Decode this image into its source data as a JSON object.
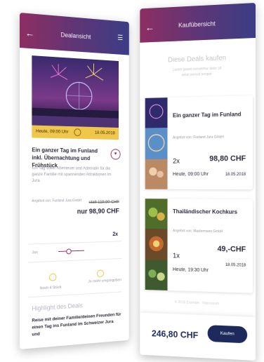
{
  "left": {
    "header": {
      "back": "←",
      "title": "Dealansicht",
      "menu": "☰"
    },
    "card": {
      "date": "Heute, 09:00 Uhr",
      "date_right": "18.05.2018"
    },
    "title": "Ein ganzer Tag im Funland inkl. Übernachtung und Frühstück",
    "description": "Ein Tag voller Abenteuer und Adrenalin für die ganze Familie mit spannenden Attraktionen im Jura",
    "provider": "Angebot von: Funland Jura GmbH",
    "price_old": "statt 119,90 CHF",
    "price_now": "nur 98,90 CHF",
    "quantity": "2x",
    "row1_left": "Jan",
    "row2_left": "Noch 4 Stück",
    "row2_right": "Je mehr umgangeben",
    "highlights_title": "Highlight des Deals",
    "highlights_text": "Reise mit deiner Familie/deinen Freunden für einen Tag ins Funland im Schweizer Jura und"
  },
  "right": {
    "header": {
      "back": "←",
      "title": "Kaufübersicht"
    },
    "heading": "Diese Deals kaufen",
    "subheading": "Lorem ipsum consetetur dolor sit amet eirmod tempor",
    "items": [
      {
        "title": "Ein ganzer Tag im Funland",
        "provider": "Angebot von: Funland Jura GmbH",
        "qty": "2x",
        "price": "98,80 CHF",
        "time": "Heute, 09:00 Uhr",
        "date": "18.05.2018"
      },
      {
        "title": "Thailändischer Kochkurs",
        "provider": "Angebot von: Mastermann GmbH",
        "qty": "1x",
        "price": "49,-CHF",
        "time": "Heute, 19:30 Uhr",
        "date": "18.05.2018"
      }
    ],
    "footer_note": "© 2018 Example · Impressum",
    "total": "246,80 CHF",
    "buy_label": "Kaufen"
  },
  "colors": {
    "purple": "#5f3576",
    "magenta": "#8e2e62",
    "navy": "#1f2a5c",
    "gold": "#f0c64b"
  }
}
